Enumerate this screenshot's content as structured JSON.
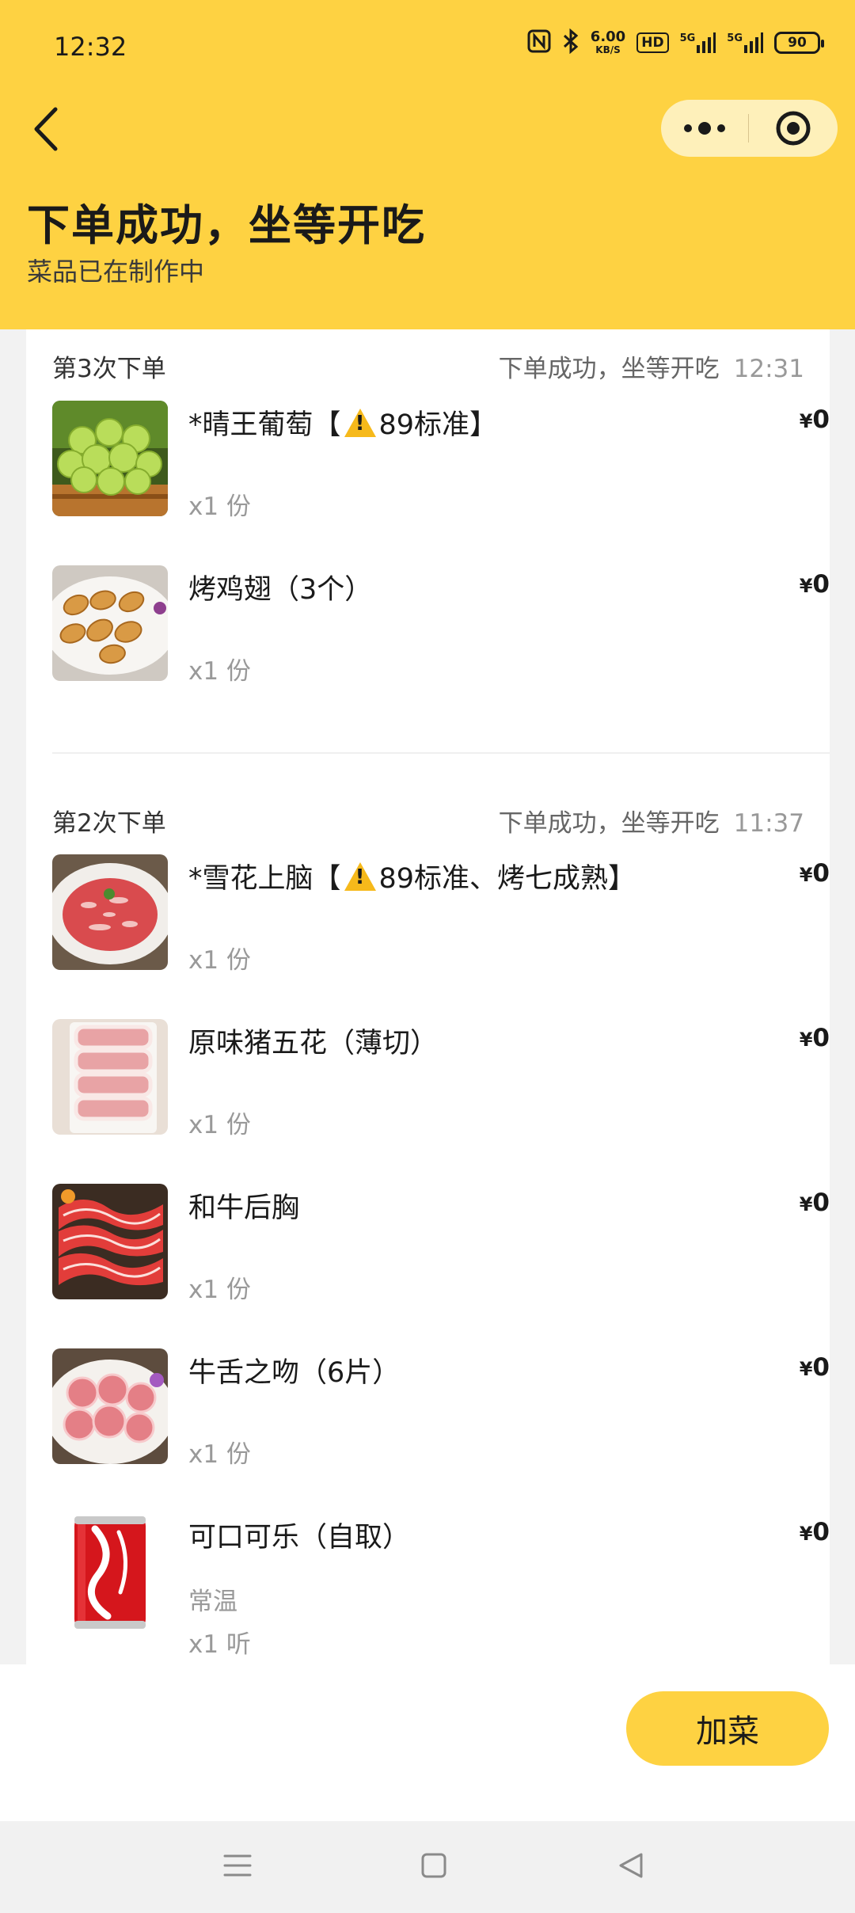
{
  "status_bar": {
    "time": "12:32",
    "net_speed_top": "6.00",
    "net_speed_bottom": "KB/S",
    "hd": "HD",
    "sig1": "5G",
    "sig2": "5G",
    "battery": "90"
  },
  "header": {
    "title": "下单成功，坐等开吃",
    "subtitle": "菜品已在制作中"
  },
  "currency": "¥",
  "orders": [
    {
      "label": "第3次下单",
      "status": "下单成功，坐等开吃",
      "time": "12:31",
      "items": [
        {
          "name_prefix": "*晴王葡萄【",
          "name_suffix": "89标准】",
          "price": "0",
          "qty": "x1 份"
        },
        {
          "name": "烤鸡翅（3个）",
          "price": "0",
          "qty": "x1 份"
        }
      ]
    },
    {
      "label": "第2次下单",
      "status": "下单成功，坐等开吃",
      "time": "11:37",
      "items": [
        {
          "name_prefix": "*雪花上脑【",
          "name_suffix": "89标准、烤七成熟】",
          "price": "0",
          "qty": "x1 份"
        },
        {
          "name": "原味猪五花（薄切）",
          "price": "0",
          "qty": "x1 份"
        },
        {
          "name": "和牛后胸",
          "price": "0",
          "qty": "x1 份"
        },
        {
          "name": "牛舌之吻（6片）",
          "price": "0",
          "qty": "x1 份"
        },
        {
          "name": "可口可乐（自取）",
          "option": "常温",
          "price": "0",
          "qty": "x1 听"
        }
      ]
    }
  ],
  "bottom": {
    "add_button": "加菜"
  },
  "colors": {
    "brand_yellow": "#fed242",
    "capsule": "#fef0ba",
    "muted_text": "#999999"
  }
}
